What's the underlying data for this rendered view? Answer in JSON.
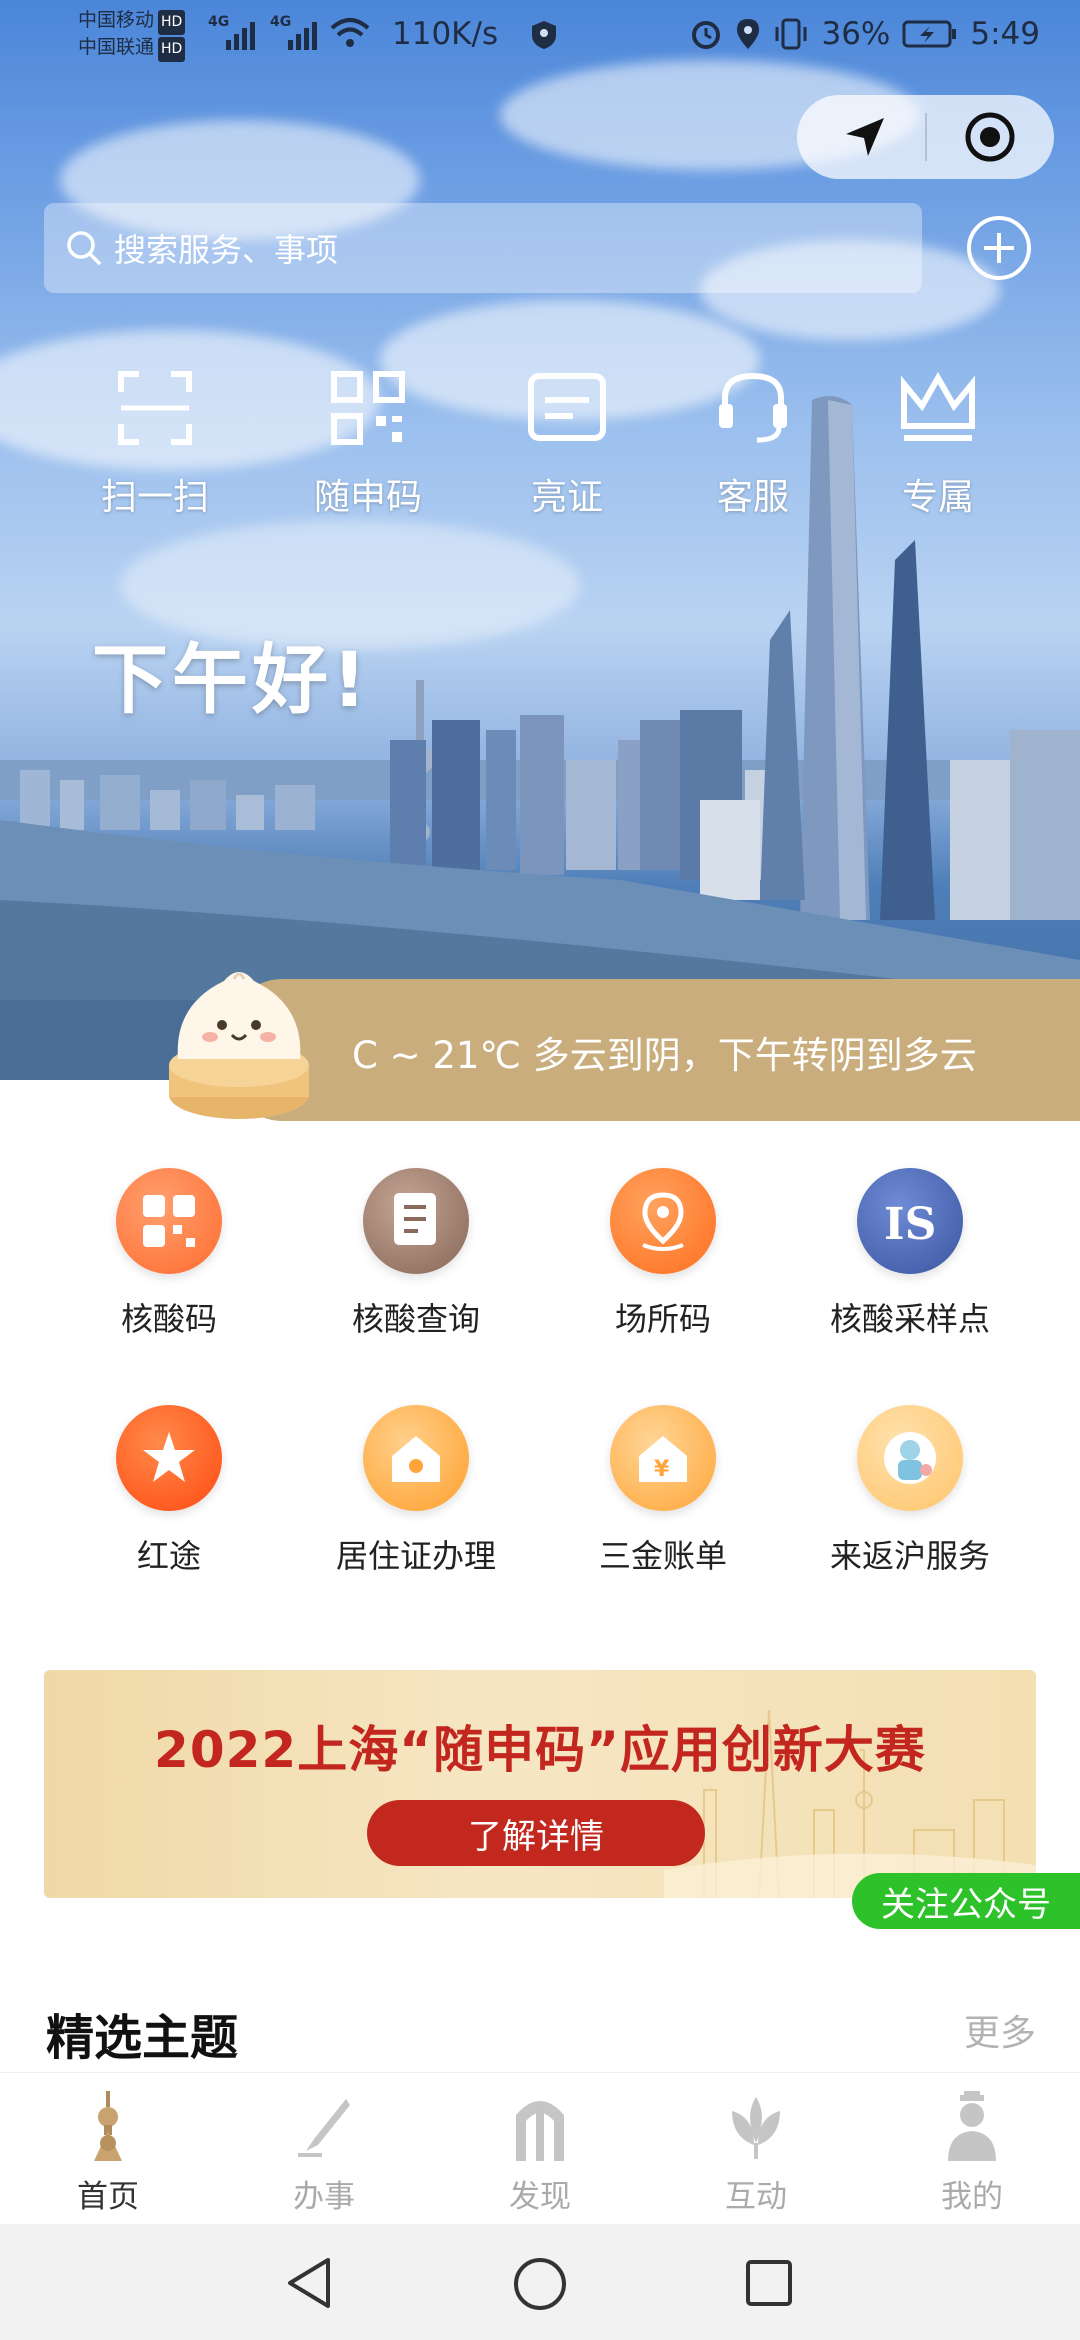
{
  "status_bar": {
    "carrier1": "中国移动",
    "carrier2": "中国联通",
    "hd": "HD",
    "net1": "4G",
    "net2": "4G",
    "speed": "110K/s",
    "battery": "36%",
    "time": "5:49"
  },
  "search": {
    "placeholder": "搜索服务、事项"
  },
  "quick_actions": [
    {
      "label": "扫一扫",
      "icon": "scan-icon"
    },
    {
      "label": "随申码",
      "icon": "qrcode-icon"
    },
    {
      "label": "亮证",
      "icon": "certificate-icon"
    },
    {
      "label": "客服",
      "icon": "customer-service-icon"
    },
    {
      "label": "专属",
      "icon": "crown-icon"
    }
  ],
  "greeting": "下午好!",
  "weather": {
    "text": "C ~ 21℃ 多云到阴，下午转阴到多云"
  },
  "services": [
    {
      "label": "核酸码",
      "icon": "qrcode-icon",
      "color": "#ff7a3c"
    },
    {
      "label": "核酸查询",
      "icon": "document-icon",
      "color": "#9a7a68"
    },
    {
      "label": "场所码",
      "icon": "location-pin-icon",
      "color": "#ff8030"
    },
    {
      "label": "核酸采样点",
      "icon": "is-logo-icon",
      "color": "#4e6cb8"
    },
    {
      "label": "红途",
      "icon": "star-tower-icon",
      "color": "#ff5a1f"
    },
    {
      "label": "居住证办理",
      "icon": "house-icon",
      "color": "#ffa83a"
    },
    {
      "label": "三金账单",
      "icon": "yen-house-icon",
      "color": "#ffad45"
    },
    {
      "label": "来返沪服务",
      "icon": "mascot-icon",
      "color": "#ffc870"
    }
  ],
  "banner": {
    "title": "2022上海“随申码”应用创新大赛",
    "button": "了解详情"
  },
  "follow_button": "关注公众号",
  "section": {
    "title": "精选主题",
    "more": "更多"
  },
  "tabs": [
    {
      "label": "首页",
      "icon": "pearl-tower-icon",
      "active": true
    },
    {
      "label": "办事",
      "icon": "pen-icon",
      "active": false
    },
    {
      "label": "发现",
      "icon": "arch-icon",
      "active": false
    },
    {
      "label": "互动",
      "icon": "magnolia-icon",
      "active": false
    },
    {
      "label": "我的",
      "icon": "person-icon",
      "active": false
    }
  ]
}
